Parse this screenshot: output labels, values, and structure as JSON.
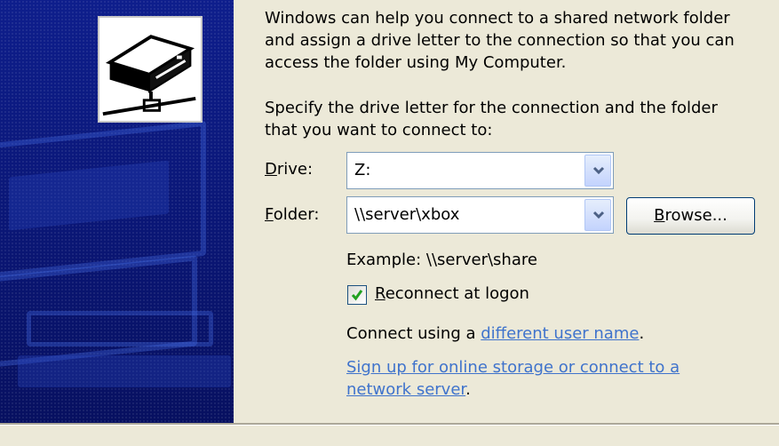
{
  "intro": {
    "lines": [
      "Windows can help you connect to a shared network folder",
      "and assign a drive letter to the connection so that you can",
      "access the folder using My Computer."
    ]
  },
  "specify": {
    "lines": [
      "Specify the drive letter for the connection and the folder",
      "that you want to connect to:"
    ]
  },
  "drive": {
    "label_accel": "D",
    "label_rest": "rive:",
    "value": "Z:"
  },
  "folder": {
    "label_accel": "F",
    "label_rest": "older:",
    "value": "\\\\server\\xbox"
  },
  "browse": {
    "label_accel": "B",
    "label_rest": "rowse..."
  },
  "example": "Example: \\\\server\\share",
  "reconnect": {
    "label_accel": "R",
    "label_rest": "econnect at logon",
    "checked": true
  },
  "connect_using": {
    "prefix": "Connect using a ",
    "link": "different user name",
    "suffix": "."
  },
  "signup": {
    "line1": "Sign up for online storage or connect to a",
    "line2": "network server",
    "suffix": "."
  },
  "icons": {
    "drive": "network-drive-icon",
    "dropdown": "chevron-down-icon",
    "check": "checkmark-icon"
  },
  "colors": {
    "panel": "#0E1E8C",
    "link": "#3F73CC",
    "dialog": "#ECE9D8"
  }
}
